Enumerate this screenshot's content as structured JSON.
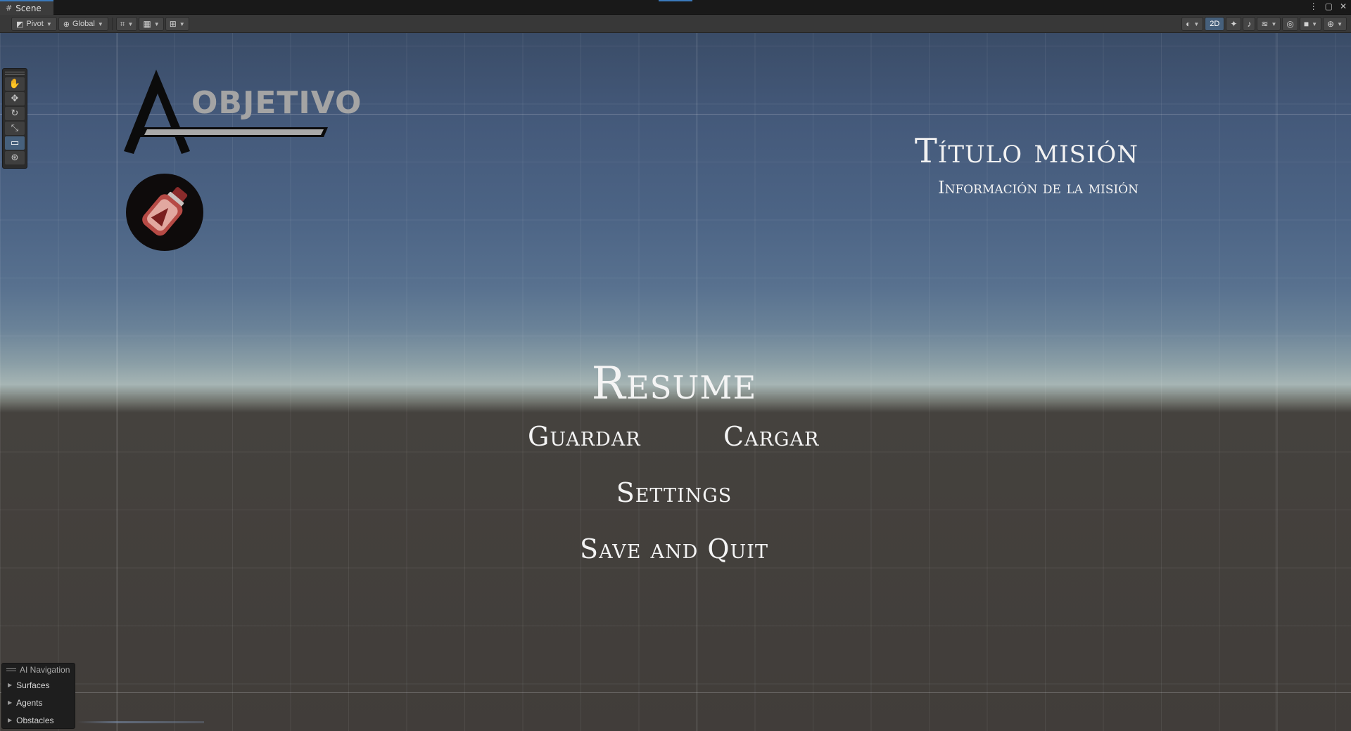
{
  "tab": {
    "label": "Scene"
  },
  "toolbar": {
    "pivot_label": "Pivot",
    "global_label": "Global",
    "mode_2d_label": "2D"
  },
  "scene": {
    "objective": {
      "title": "OBJETIVO",
      "progress": 0
    },
    "mission": {
      "title": "Título misión",
      "info": "Información de la misión"
    },
    "menu": {
      "resume": "Resume",
      "guardar": "Guardar",
      "cargar": "Cargar",
      "settings": "Settings",
      "save_and_quit": "Save and Quit"
    }
  },
  "ai_navigation": {
    "title": "AI Navigation",
    "items": [
      {
        "label": "Surfaces"
      },
      {
        "label": "Agents"
      },
      {
        "label": "Obstacles"
      }
    ]
  },
  "icons": [
    "hand-tool-icon",
    "move-tool-icon",
    "rotate-tool-icon",
    "scale-tool-icon",
    "rect-tool-icon",
    "transform-tool-icon"
  ]
}
